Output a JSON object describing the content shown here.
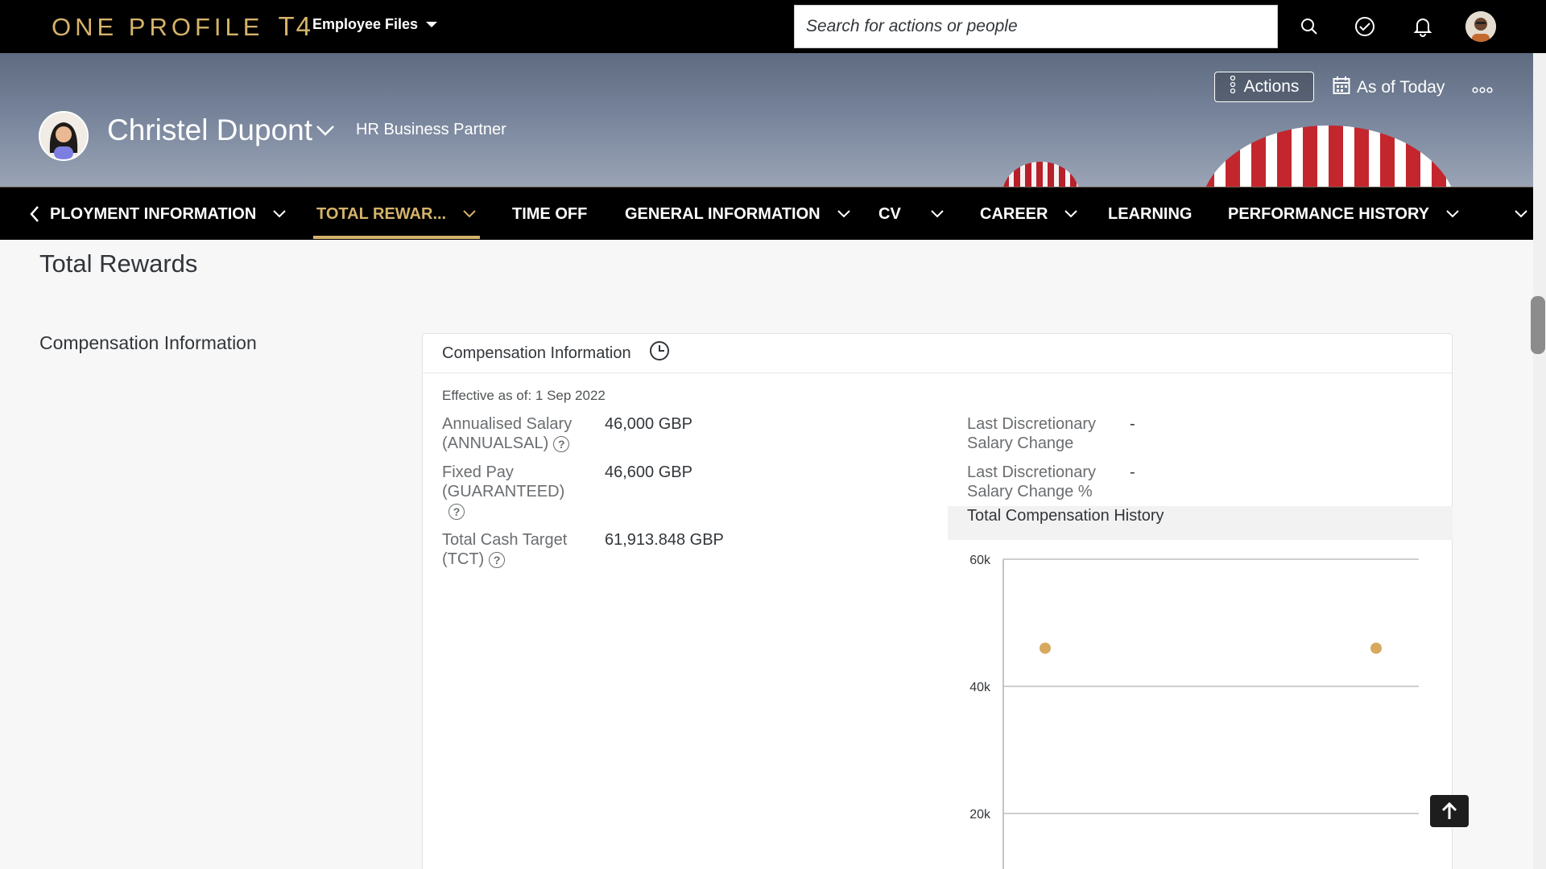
{
  "shell": {
    "logo_main": "ONE PROFILE",
    "logo_suffix": "T4",
    "menu_label": "Employee Files",
    "search_placeholder": "Search for actions or people",
    "icons": [
      "search-icon",
      "approvals-icon",
      "bell-icon",
      "user-avatar"
    ]
  },
  "header": {
    "name": "Christel Dupont",
    "job_title": "HR Business Partner",
    "actions_label": "Actions",
    "as_of_label": "As of Today"
  },
  "tabs": [
    {
      "label": "PLOYMENT INFORMATION",
      "has_menu": true,
      "active": false
    },
    {
      "label": "TOTAL REWAR...",
      "has_menu": true,
      "active": true
    },
    {
      "label": "TIME OFF",
      "has_menu": false,
      "active": false
    },
    {
      "label": "GENERAL INFORMATION",
      "has_menu": true,
      "active": false
    },
    {
      "label": "CV",
      "has_menu": true,
      "active": false
    },
    {
      "label": "CAREER",
      "has_menu": true,
      "active": false
    },
    {
      "label": "LEARNING",
      "has_menu": false,
      "active": false
    },
    {
      "label": "PERFORMANCE HISTORY",
      "has_menu": true,
      "active": false
    }
  ],
  "content": {
    "section_title": "Total Rewards",
    "side_label": "Compensation Information",
    "card": {
      "title": "Compensation Information",
      "effective": "Effective as of: 1 Sep 2022",
      "fields_left": [
        {
          "label_line1": "Annualised Salary",
          "label_line2": "(ANNUALSAL)",
          "value": "46,000 GBP"
        },
        {
          "label_line1": "Fixed Pay",
          "label_line2": "(GUARANTEED)",
          "value": "46,600 GBP"
        },
        {
          "label_line1": "Total Cash Target",
          "label_line2": "(TCT)",
          "value": "61,913.848 GBP"
        }
      ],
      "fields_right": [
        {
          "label_line1": "Last Discretionary",
          "label_line2": "Salary Change",
          "value": "-"
        },
        {
          "label_line1": "Last Discretionary",
          "label_line2": "Salary Change %",
          "value": "-"
        }
      ],
      "history_title": "Total Compensation History"
    }
  },
  "chart_data": {
    "type": "scatter",
    "title": "Total Compensation History",
    "y_ticks": [
      "60k",
      "40k",
      "20k"
    ],
    "ylim": [
      0,
      60000
    ],
    "series": [
      {
        "values": [
          46000,
          46000
        ],
        "color": "#d6a95e"
      }
    ],
    "grid": true
  }
}
